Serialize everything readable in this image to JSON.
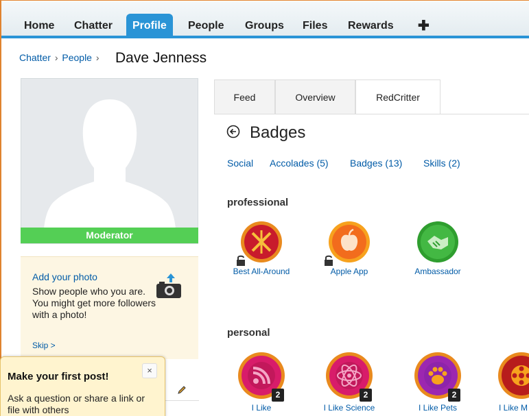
{
  "nav": {
    "items": [
      "Home",
      "Chatter",
      "Profile",
      "People",
      "Groups",
      "Files",
      "Rewards"
    ],
    "active": "Profile",
    "plus": "✚"
  },
  "breadcrumb": {
    "items": [
      "Chatter",
      "People"
    ],
    "separator": "›"
  },
  "page_title": "Dave Jenness",
  "profile": {
    "role_badge": "Moderator"
  },
  "add_photo": {
    "title": "Add your photo",
    "description": "Show people who you are. You might get more followers with a photo!",
    "skip": "Skip >"
  },
  "tabs": [
    "Feed",
    "Overview",
    "RedCritter"
  ],
  "active_tab": "RedCritter",
  "section_title": "Badges",
  "filters": [
    "Social",
    "Accolades (5)",
    "Badges (13)",
    "Skills (2)"
  ],
  "categories": {
    "professional": "professional",
    "personal": "personal"
  },
  "professional_badges": [
    {
      "label": "Best All-Around",
      "locked": true,
      "icon": "swords-icon"
    },
    {
      "label": "Apple App",
      "locked": true,
      "icon": "apple-icon"
    },
    {
      "label": "Ambassador",
      "locked": false,
      "icon": "handshake-icon"
    }
  ],
  "personal_badges": [
    {
      "label": "I Like",
      "count": "2",
      "icon": "rss-icon"
    },
    {
      "label": "I Like Science",
      "count": "2",
      "icon": "atom-icon"
    },
    {
      "label": "I Like Pets",
      "count": "2",
      "icon": "paw-icon"
    },
    {
      "label": "I Like M",
      "icon": "film-reel-icon"
    }
  ],
  "popover": {
    "title": "Make your first post!",
    "body": "Ask a question or share a link or file with others",
    "close": "×"
  },
  "colors": {
    "accent": "#2a94d6",
    "moderator": "#54cf55",
    "link": "#015ba7",
    "frame": "#e0832f"
  }
}
